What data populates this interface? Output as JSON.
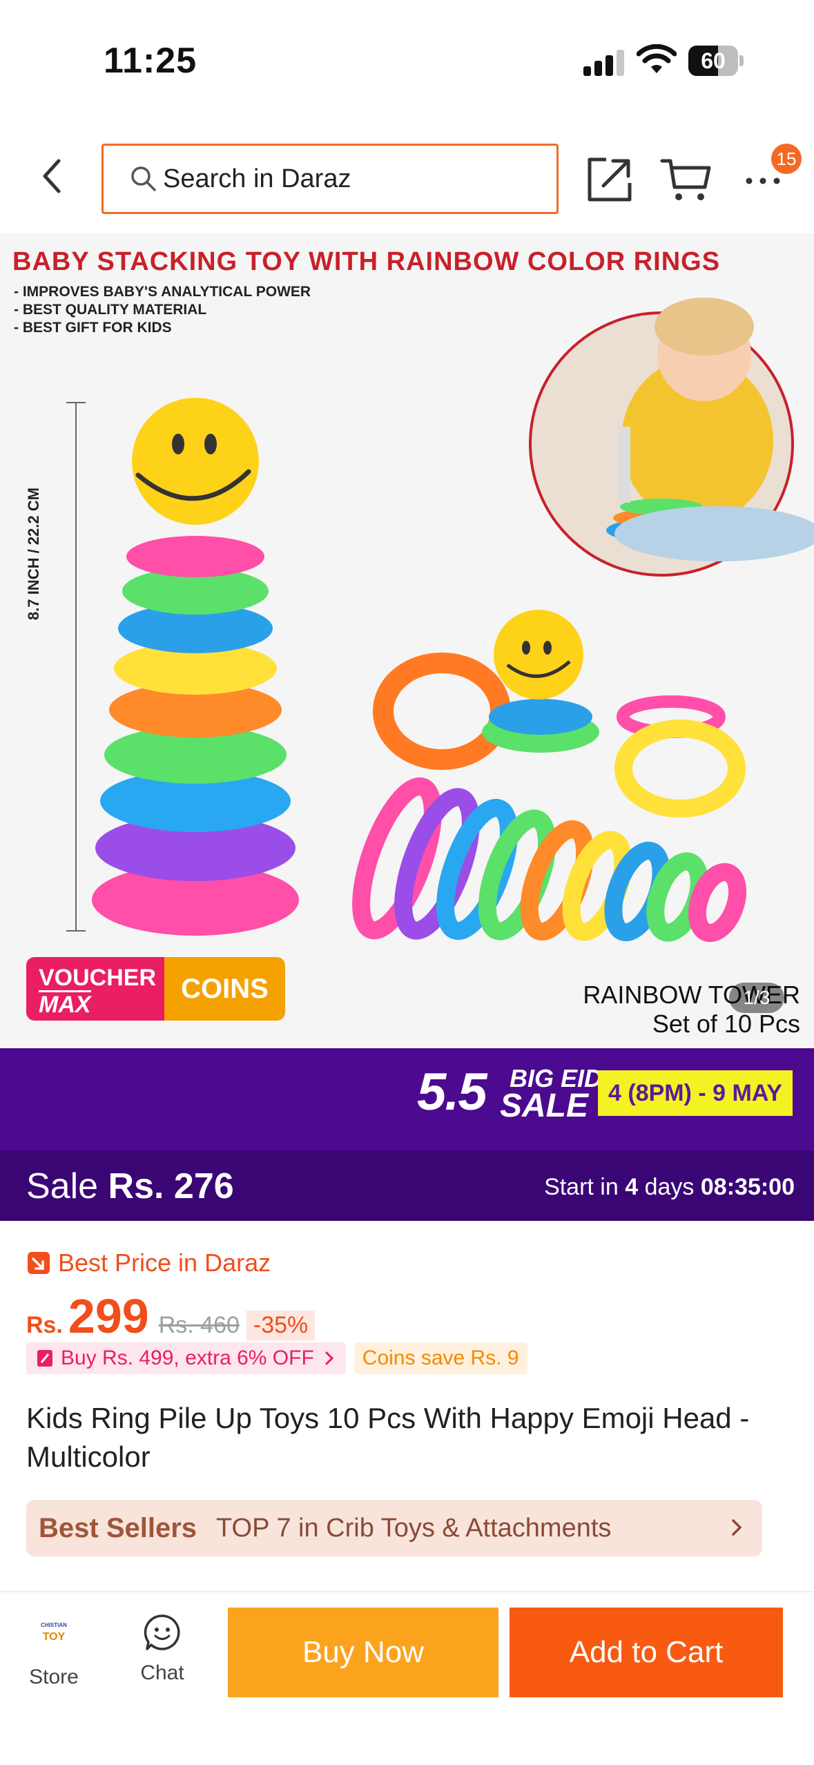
{
  "status": {
    "time": "11:25",
    "battery": "60",
    "battery_level": 0.6,
    "signal_bars": 3
  },
  "header": {
    "search_placeholder": "Search in Daraz",
    "more_badge": "15"
  },
  "product_image": {
    "title": "BABY STACKING TOY WITH RAINBOW COLOR RINGS",
    "bullets": [
      "- IMPROVES BABY'S ANALYTICAL POWER",
      "- BEST QUALITY MATERIAL",
      "- BEST GIFT FOR KIDS"
    ],
    "dimension": "8.7 INCH / 22.2 CM",
    "voucher_label": "VOUCHER",
    "voucher_max": "MAX",
    "coins_label": "COINS",
    "caption_line1": "RAINBOW TOWER",
    "caption_line2": "Set of 10 Pcs",
    "counter": "1/3",
    "ring_colors": [
      "#ff4fa8",
      "#9b4de8",
      "#29a7f0",
      "#5be06a",
      "#ff8a2a",
      "#ffe13a",
      "#2aa0e8",
      "#5be06a",
      "#ff4fa8"
    ]
  },
  "sale_banner": {
    "number": "5.5",
    "big_eid": "BIG EID",
    "sale": "SALE",
    "dates": "4 (8PM) - 9 MAY",
    "sale_prefix": "Sale",
    "sale_price": "Rs. 276",
    "start_in": "Start in",
    "days_num": "4",
    "days_word": "days",
    "countdown": "08:35:00"
  },
  "product": {
    "best_price": "Best Price in Daraz",
    "currency": "Rs.",
    "price": "299",
    "old_price": "Rs. 460",
    "discount": "-35%",
    "promo_deal": "Buy Rs. 499, extra 6% OFF",
    "promo_coins": "Coins save Rs. 9",
    "title": "Kids Ring Pile Up Toys 10 Pcs With Happy Emoji Head - Multicolor",
    "best_sellers_label": "Best Sellers",
    "best_sellers_rank": "TOP 7 in Crib Toys & Attachments"
  },
  "bottom_bar": {
    "store_logo_top": "CHISTIAN",
    "store_logo": "TOY",
    "store_label": "Store",
    "chat_label": "Chat",
    "buy_now": "Buy Now",
    "add_to_cart": "Add to Cart"
  },
  "colors": {
    "brand_orange": "#f36a23",
    "buy_now": "#fca31e",
    "add_to_cart": "#f85a12",
    "sale_purple": "#4b0a8f"
  }
}
